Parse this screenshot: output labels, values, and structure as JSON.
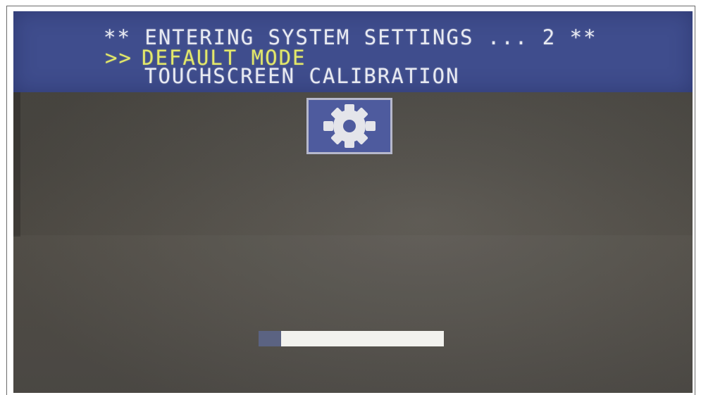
{
  "menu": {
    "title": "** ENTERING SYSTEM SETTINGS ... 2 **",
    "cursor": ">>",
    "items": [
      {
        "label": "DEFAULT MODE",
        "selected": true
      },
      {
        "label": "TOUCHSCREEN CALIBRATION",
        "selected": false
      }
    ]
  },
  "icon": {
    "name": "gear-icon"
  },
  "progress": {
    "value": 0.12
  },
  "colors": {
    "header": "#3f4d8d",
    "selected_text": "#e3e86a",
    "text": "#e8eaf2",
    "screen": "#4f4c46",
    "progress_track": "#f2f2ee",
    "progress_fill": "#5b6382"
  }
}
